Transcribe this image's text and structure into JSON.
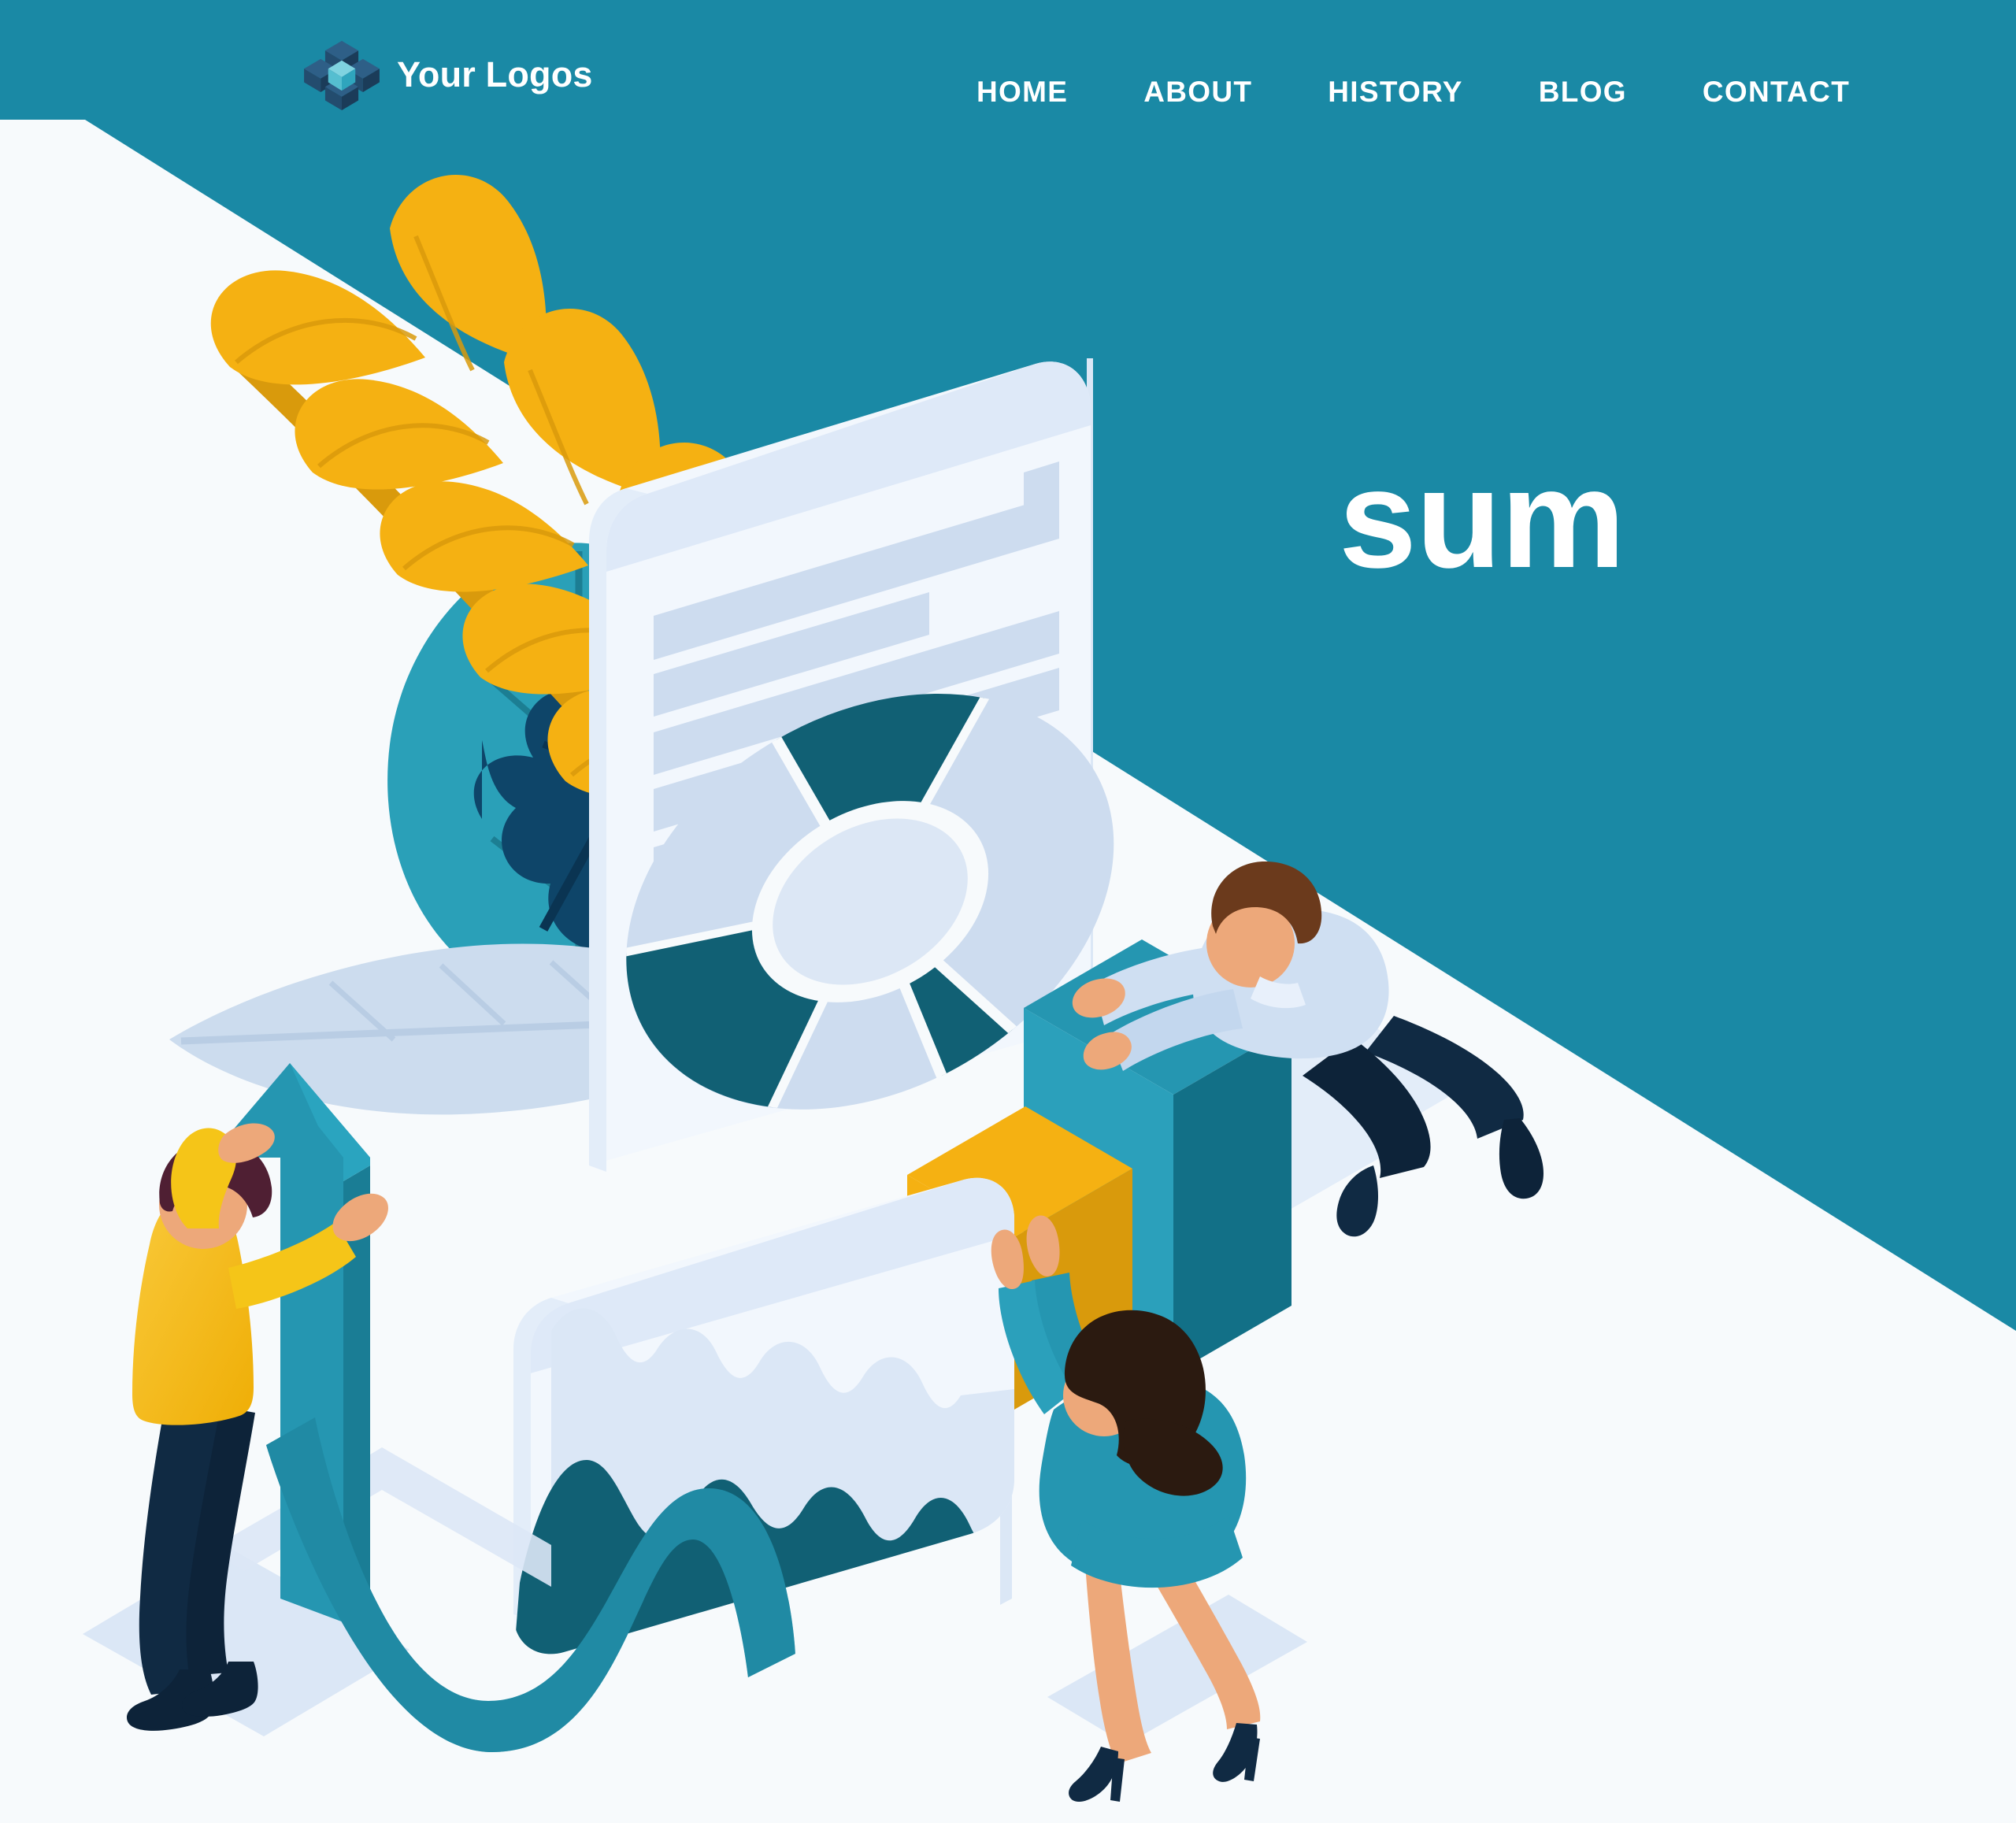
{
  "page": {
    "background_color": "#f7fafc",
    "accent_teal": "#1a89a5",
    "accent_yellow": "#f5b112",
    "accent_dark_teal": "#116074",
    "accent_navy": "#0d2f4f",
    "panel_light": "#f2f7fd",
    "panel_shadow": "#cddcef"
  },
  "header": {
    "brand": {
      "logo_icon": "isometric-cube-logo",
      "label": "Your Logos"
    },
    "nav": {
      "items": [
        {
          "label": "HOME"
        },
        {
          "label": "ABOUT"
        },
        {
          "label": "HISTORY"
        },
        {
          "label": "BLOG"
        },
        {
          "label": "CONTACT"
        }
      ]
    }
  },
  "hero": {
    "title": "sum"
  },
  "illustration": {
    "name": "isometric-business-analytics-scene",
    "elements": [
      {
        "name": "yellow-fern-plant",
        "color": "#f5b112"
      },
      {
        "name": "teal-leaf",
        "color": "#2aa0b8"
      },
      {
        "name": "navy-oak-leaf",
        "color": "#0e4569"
      },
      {
        "name": "light-feather-leaf",
        "color": "#ccdcee"
      },
      {
        "name": "document-panel",
        "color": "#f2f7fd"
      },
      {
        "name": "donut-chart",
        "segments_color": [
          "#116074",
          "#cddcef"
        ]
      },
      {
        "name": "area-chart-card",
        "color": "#f2f7fd",
        "series_color": "#116074"
      },
      {
        "name": "teal-bar-cube",
        "color": "#2596b1"
      },
      {
        "name": "yellow-bar-cube",
        "color": "#f5b112"
      },
      {
        "name": "growth-arrow",
        "color": "#2596b1"
      },
      {
        "name": "wave-ribbon",
        "color": "#2596b1"
      },
      {
        "name": "person-man-yellow-sweater",
        "shirt_color": "#f5c518",
        "pants_color": "#0d2339"
      },
      {
        "name": "person-man-blue-shirt",
        "shirt_color": "#cfdff2",
        "pants_color": "#102a43"
      },
      {
        "name": "person-woman-teal-dress",
        "dress_color": "#2596b1",
        "hair_color": "#2b1a10"
      }
    ]
  }
}
